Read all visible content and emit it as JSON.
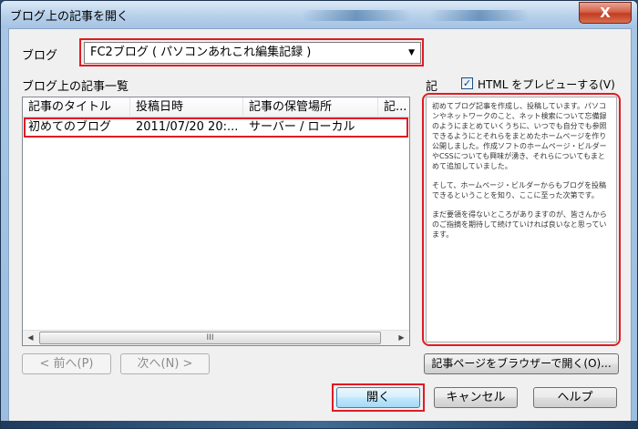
{
  "window": {
    "title": "ブログ上の記事を開く",
    "close_label": "X"
  },
  "blog": {
    "label": "ブログ",
    "selected": "FC2ブログ ( パソコンあれこれ編集記録 )"
  },
  "list": {
    "heading": "ブログ上の記事一覧",
    "columns": [
      "記事のタイトル",
      "投稿日時",
      "記事の保管場所",
      "記..."
    ],
    "rows": [
      [
        "初めてのブログ",
        "2011/07/20 20:...",
        "サーバー / ローカル",
        ""
      ]
    ],
    "scroll_thumb": "III"
  },
  "preview": {
    "label": "記",
    "checkbox_label": "HTML をプレビューする(V)",
    "checked": true,
    "paragraphs": [
      "初めてブログ記事を作成し、投稿しています。パソコンやネットワークのこと、ネット検索について忘備録のようにまとめていくうちに、いつでも自分でも参照できるようにとそれらをまとめたホームページを作り公開しました。作成ソフトのホームページ・ビルダーやCSSについても興味が湧き、それらについてもまとめて追加していました。",
      "そして、ホームページ・ビルダーからもブログを投稿できるということを知り、ここに至った次第です。",
      "まだ要領を得ないところがありますのが、皆さんからのご指摘を期待して続けていければ良いなと思っています。"
    ]
  },
  "nav": {
    "prev": "< 前へ(P)",
    "next": "次へ(N) >"
  },
  "buttons": {
    "browser": "記事ページをブラウザーで開く(O)...",
    "open": "開く",
    "cancel": "キャンセル",
    "help": "ヘルプ"
  },
  "colors": {
    "highlight_box": "#e01b24"
  }
}
